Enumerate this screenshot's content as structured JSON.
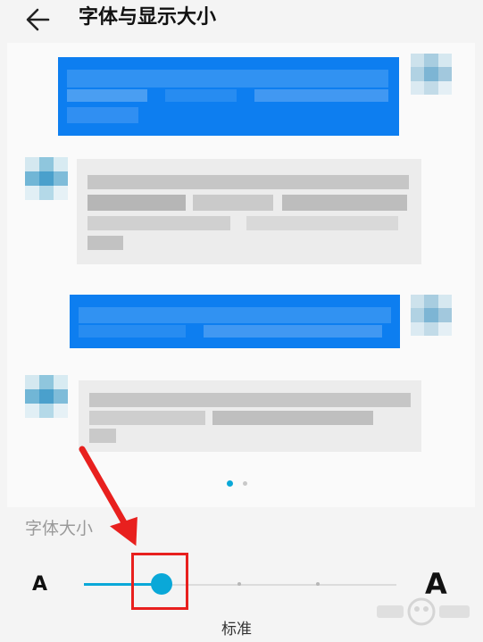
{
  "header": {
    "back_icon": "arrow-left-icon",
    "title": "字体与显示大小"
  },
  "preview": {
    "page_indicator": {
      "count": 2,
      "active_index": 0
    },
    "colors": {
      "sent_bubble": "#0d7ef0",
      "received_bubble": "#ececec",
      "accent": "#0aa8d8"
    }
  },
  "font_size": {
    "label": "字体大小",
    "small_glyph": "A",
    "large_glyph": "A",
    "levels": 5,
    "current_level_index": 1,
    "current_level_label": "标准"
  },
  "annotation": {
    "color": "#e8201e"
  },
  "watermark": {
    "icon": "baidu-logo-icon"
  }
}
